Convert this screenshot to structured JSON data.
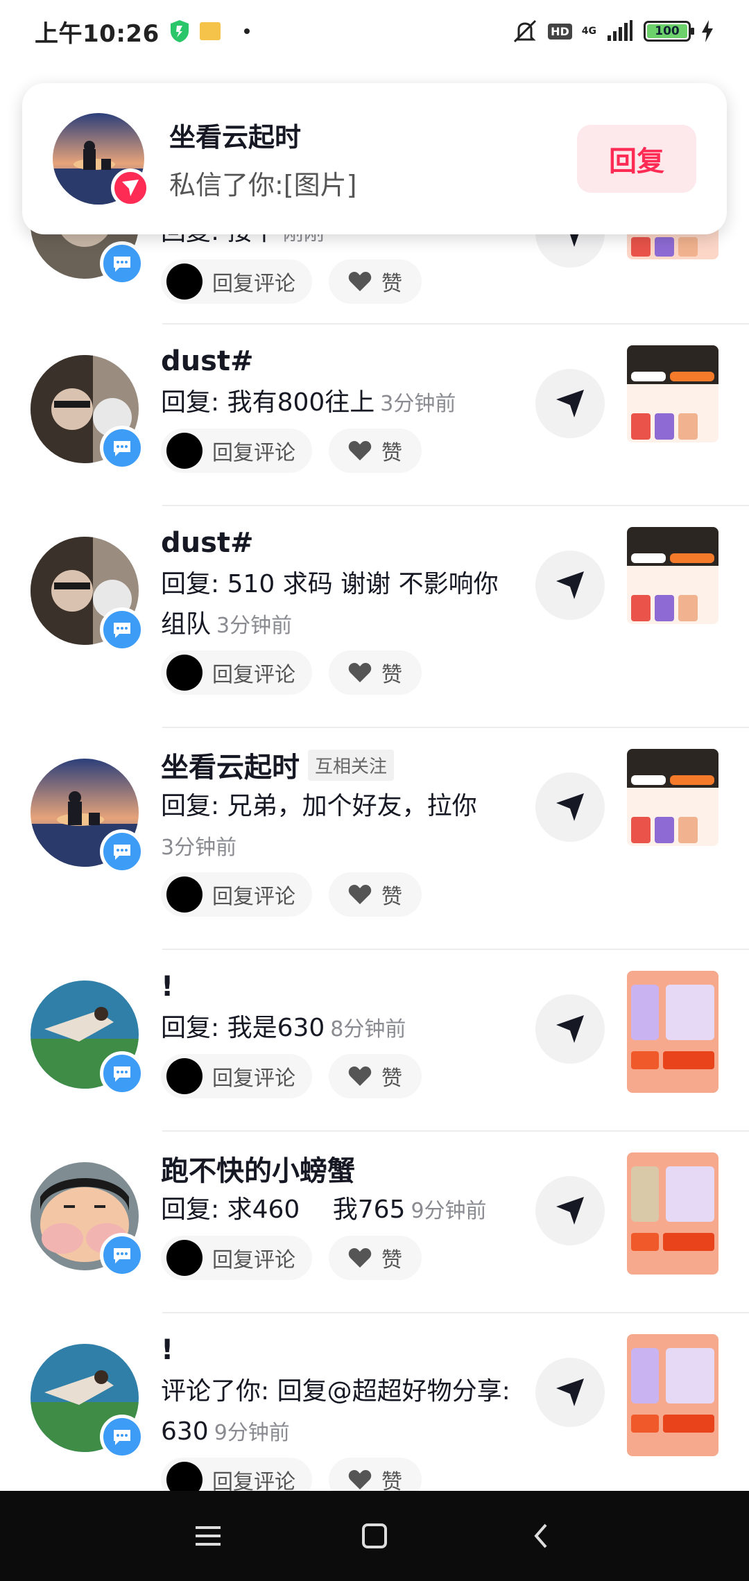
{
  "status_bar": {
    "time": "上午10:26",
    "hd": "HD",
    "network": "4G",
    "battery": "100"
  },
  "notification": {
    "title": "坐看云起时",
    "subtitle": "私信了你:[图片]",
    "reply_button": "回复"
  },
  "actions": {
    "reply_comment": "回复评论",
    "like": "赞"
  },
  "rows": [
    {
      "name": "dust#",
      "tag": "",
      "text": "回复: 我有800往上",
      "time": "3分钟前"
    },
    {
      "name": "dust#",
      "tag": "",
      "text": "回复: 510 求码 谢谢 不影响你组队",
      "time": "3分钟前"
    },
    {
      "name": "坐看云起时",
      "tag": "互相关注",
      "text": "回复: 兄弟，加个好友，拉你",
      "time": "3分钟前"
    },
    {
      "name": "!",
      "tag": "",
      "text": "回复: 我是630",
      "time": "8分钟前"
    },
    {
      "name": "跑不快的小螃蟹",
      "tag": "",
      "text": "回复: 求460　 我765",
      "time": "9分钟前"
    },
    {
      "name": "!",
      "tag": "",
      "text": "评论了你: 回复@超超好物分享: 630",
      "time": "9分钟前"
    }
  ],
  "partial_top_row": {
    "text": "回复: 接下",
    "time": "刚刚"
  }
}
